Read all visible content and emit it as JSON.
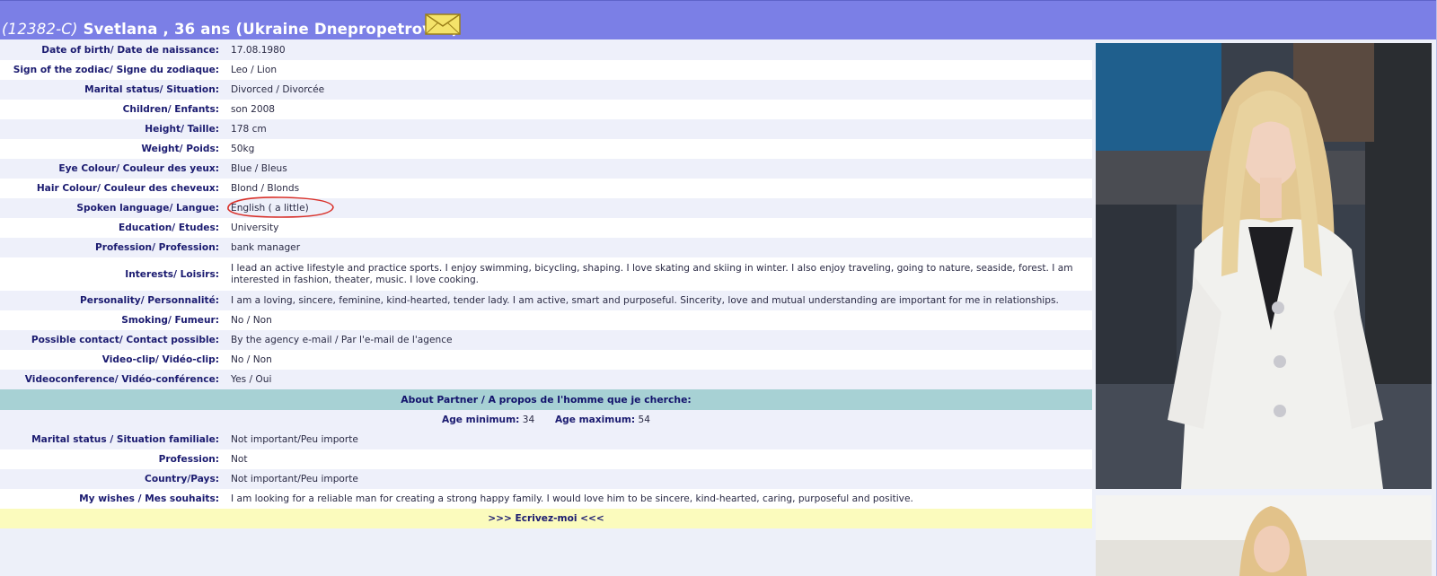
{
  "header": {
    "profile_id": "(12382-C)",
    "name_age": "Svetlana , 36 ans",
    "location": "(Ukraine Dnepropetrovsk)",
    "mail_icon": "envelope-icon"
  },
  "profile": {
    "rows": [
      {
        "label": "Date of birth/ Date de naissance:",
        "value": "17.08.1980"
      },
      {
        "label": "Sign of the zodiac/ Signe du zodiaque:",
        "value": "Leo / Lion"
      },
      {
        "label": "Marital status/ Situation:",
        "value": "Divorced / Divorcée"
      },
      {
        "label": "Children/ Enfants:",
        "value": "son 2008"
      },
      {
        "label": "Height/ Taille:",
        "value": "178 cm"
      },
      {
        "label": "Weight/ Poids:",
        "value": "50kg"
      },
      {
        "label": "Eye Colour/ Couleur des yeux:",
        "value": "Blue / Bleus"
      },
      {
        "label": "Hair Colour/ Couleur des cheveux:",
        "value": "Blond / Blonds"
      },
      {
        "label": "Spoken language/ Langue:",
        "value": "English ( a little)"
      },
      {
        "label": "Education/ Etudes:",
        "value": "University"
      },
      {
        "label": "Profession/ Profession:",
        "value": "bank manager"
      },
      {
        "label": "Interests/ Loisirs:",
        "value": "I lead an active lifestyle and practice sports. I enjoy swimming, bicycling, shaping. I love skating and skiing in winter. I also enjoy traveling, going to nature, seaside, forest. I am interested in fashion, theater, music. I love cooking."
      },
      {
        "label": "Personality/ Personnalité:",
        "value": "I am a loving, sincere, feminine, kind-hearted, tender lady. I am active, smart and purposeful. Sincerity, love and mutual understanding are important for me in relationships."
      },
      {
        "label": "Smoking/ Fumeur:",
        "value": "No / Non"
      },
      {
        "label": "Possible contact/ Contact possible:",
        "value": "By the agency e-mail / Par l'e-mail de l'agence"
      },
      {
        "label": "Video-clip/ Vidéo-clip:",
        "value": "No / Non"
      },
      {
        "label": "Videoconference/ Vidéo-conférence:",
        "value": "Yes / Oui"
      }
    ]
  },
  "partner": {
    "section_title": "About Partner / A propos de l'homme que je cherche:",
    "age_min_label": "Age minimum:",
    "age_min": "34",
    "age_max_label": "Age maximum:",
    "age_max": "54",
    "rows": [
      {
        "label": "Marital status / Situation familiale:",
        "value": "Not important/Peu importe"
      },
      {
        "label": "Profession:",
        "value": "Not"
      },
      {
        "label": "Country/Pays:",
        "value": "Not important/Peu importe"
      },
      {
        "label": "My wishes / Mes souhaits:",
        "value": "I am looking for a reliable man for creating a strong happy family. I would love him to be sincere, kind-hearted, caring, purposeful and positive."
      }
    ]
  },
  "cta": {
    "label": ">>> Ecrivez-moi <<<"
  },
  "colors": {
    "header_bg": "#7b7fe6",
    "section_bg": "#a7d1d4",
    "cta_bg": "#fbfbbd",
    "label_text": "#1b1b70",
    "annotation": "#d9312a"
  }
}
